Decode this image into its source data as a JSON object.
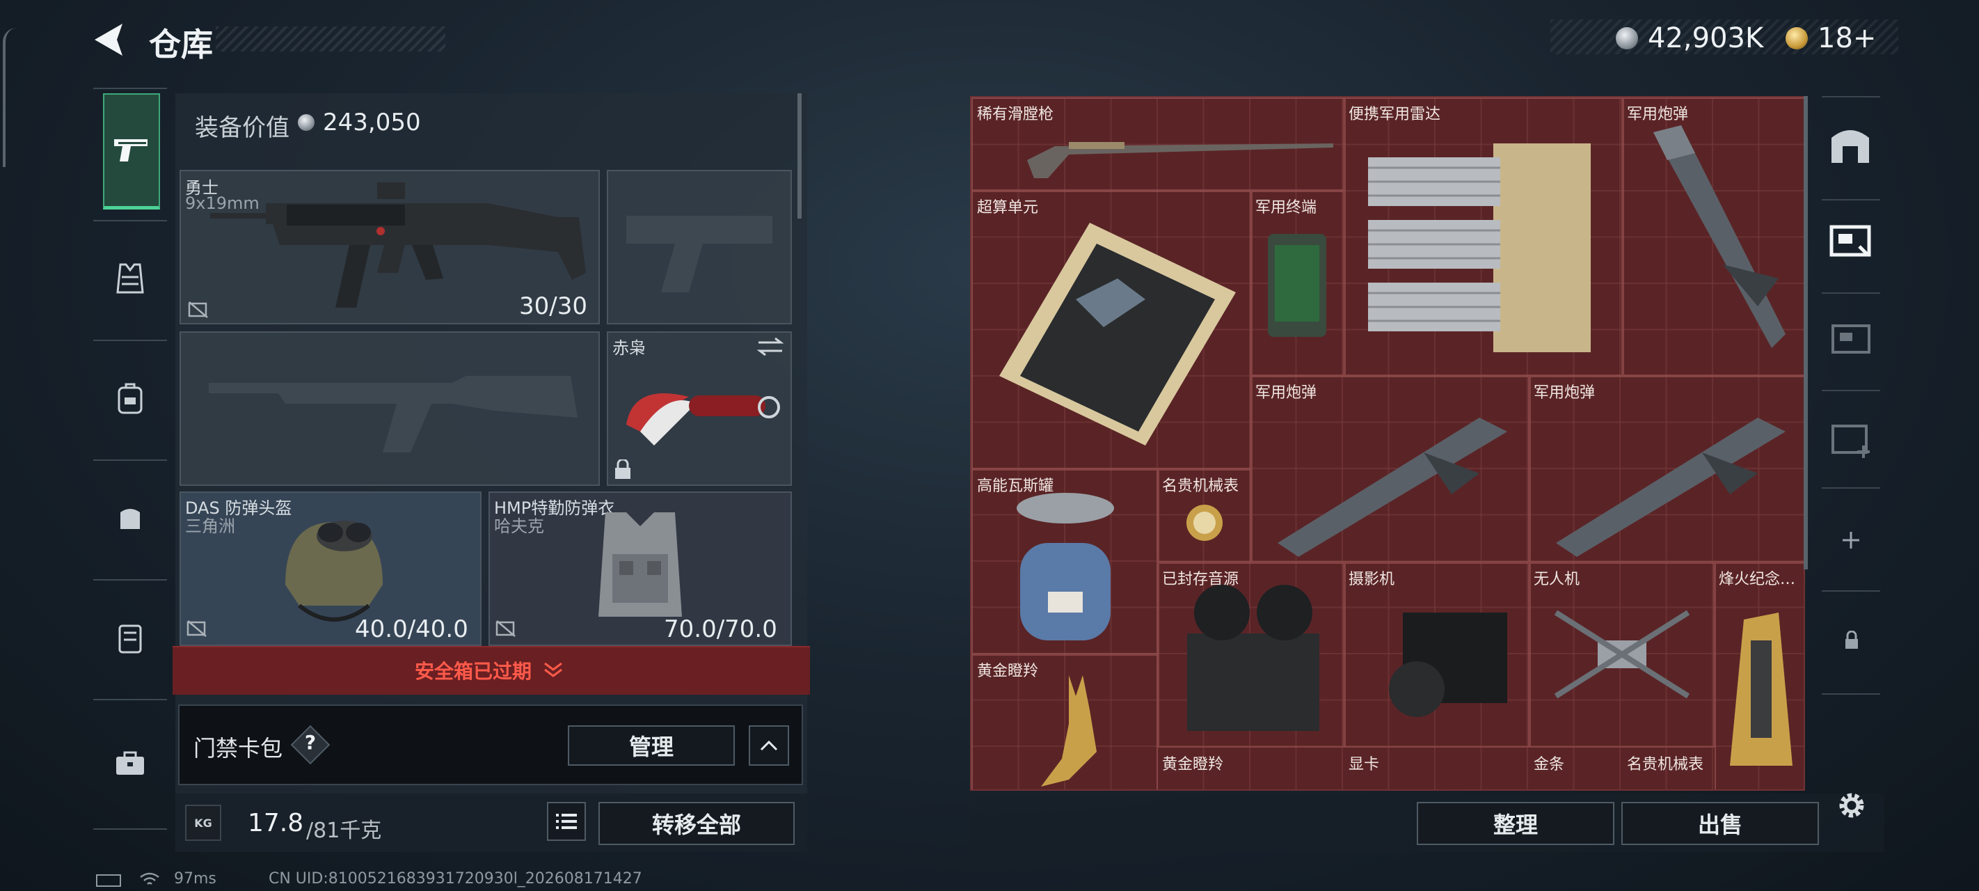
{
  "header": {
    "title": "仓库",
    "currency_silver": "42,903K",
    "currency_gold": "18+"
  },
  "equipment": {
    "value_label": "装备价值",
    "value": "243,050",
    "primary_weapon": {
      "name": "勇士",
      "caliber": "9x19mm",
      "ammo": "30/30"
    },
    "melee": {
      "name": "赤枭"
    },
    "helmet": {
      "name": "DAS 防弹头盔",
      "brand": "三角洲",
      "durability": "40.0/40.0"
    },
    "armor": {
      "name": "HMP特勤防弹衣",
      "brand": "哈夫克",
      "durability": "70.0/70.0"
    },
    "safebox_expired": "安全箱已过期",
    "keycard_label": "门禁卡包",
    "keycard_help": "?",
    "manage_button": "管理",
    "weight_current": "17.8",
    "weight_max": "/81千克",
    "weight_icon_text": "KG",
    "transfer_all": "转移全部"
  },
  "stash": {
    "items": [
      {
        "label": "稀有滑膛枪"
      },
      {
        "label": "便携军用雷达"
      },
      {
        "label": "军用炮弹"
      },
      {
        "label": "超算单元"
      },
      {
        "label": "军用终端"
      },
      {
        "label": "军用炮弹"
      },
      {
        "label": "军用炮弹"
      },
      {
        "label": "高能瓦斯罐"
      },
      {
        "label": "名贵机械表"
      },
      {
        "label": "已封存音源"
      },
      {
        "label": "摄影机"
      },
      {
        "label": "无人机"
      },
      {
        "label": "烽火纪念…"
      },
      {
        "label": "黄金瞪羚"
      },
      {
        "label": "黄金瞪羚"
      },
      {
        "label": "显卡"
      },
      {
        "label": "金条"
      },
      {
        "label": "名贵机械表"
      }
    ],
    "sort_button": "整理",
    "sell_button": "出售"
  },
  "status": {
    "ping": "97ms",
    "uid": "CN UID:8100521683931720930l_202608171427"
  },
  "colors": {
    "accent_green": "#4dd196",
    "stash_bg": "#5a2426",
    "alert_red": "#ff5a4a"
  }
}
